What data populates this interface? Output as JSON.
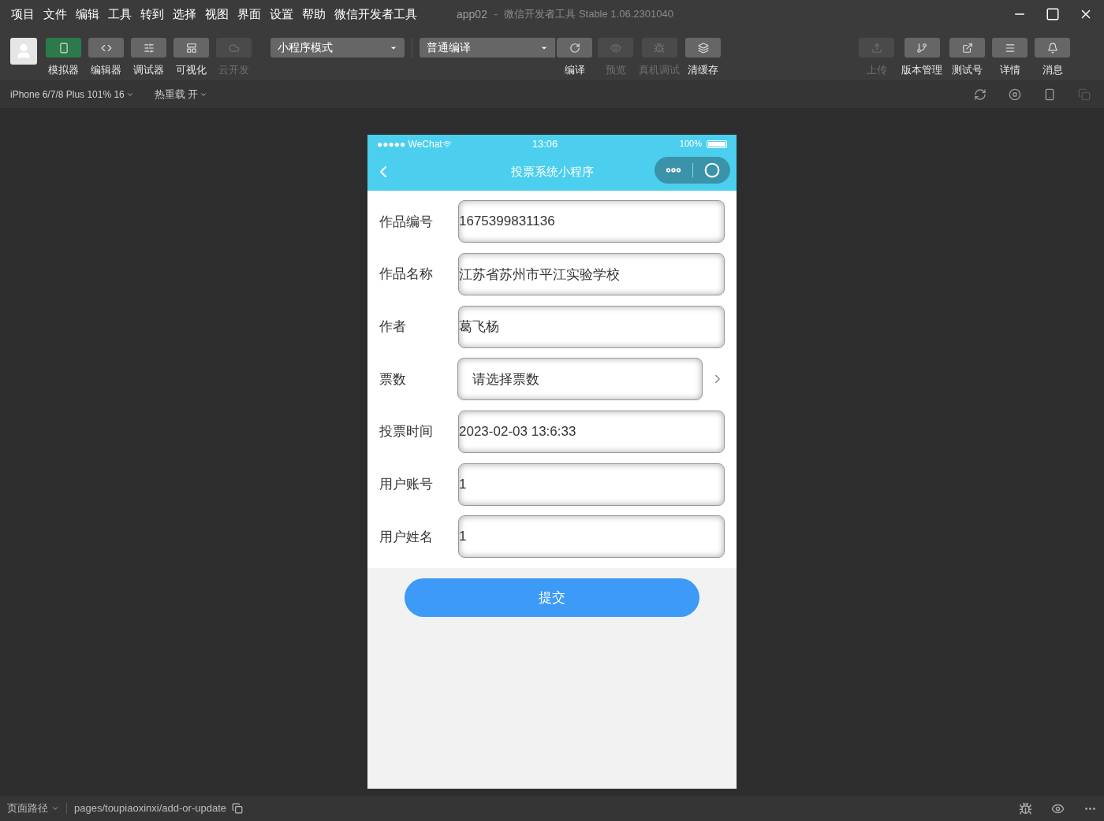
{
  "menu": [
    "项目",
    "文件",
    "编辑",
    "工具",
    "转到",
    "选择",
    "视图",
    "界面",
    "设置",
    "帮助",
    "微信开发者工具"
  ],
  "window": {
    "title": "app02",
    "separator": "-",
    "subtitle": "微信开发者工具 Stable 1.06.2301040"
  },
  "left_tools": [
    {
      "kind": "phone",
      "label": "模拟器",
      "selected": true,
      "disabled": false
    },
    {
      "kind": "code",
      "label": "编辑器",
      "selected": false,
      "disabled": false
    },
    {
      "kind": "sliders",
      "label": "调试器",
      "selected": false,
      "disabled": false
    },
    {
      "kind": "layout",
      "label": "可视化",
      "selected": false,
      "disabled": false
    },
    {
      "kind": "cloud",
      "label": "云开发",
      "selected": false,
      "disabled": true
    }
  ],
  "mode_select": "小程序模式",
  "compile_select": "普通编译",
  "compile_tools": [
    {
      "kind": "refresh",
      "label": "编译",
      "disabled": false
    },
    {
      "kind": "eye",
      "label": "预览",
      "disabled": true
    },
    {
      "kind": "bug",
      "label": "真机调试",
      "disabled": true
    },
    {
      "kind": "layers",
      "label": "清缓存",
      "disabled": false
    }
  ],
  "right_tools": [
    {
      "kind": "upload",
      "label": "上传",
      "disabled": true
    },
    {
      "kind": "branch",
      "label": "版本管理",
      "disabled": false
    },
    {
      "kind": "external",
      "label": "测试号",
      "disabled": false
    },
    {
      "kind": "menu",
      "label": "详情",
      "disabled": false
    },
    {
      "kind": "bell",
      "label": "消息",
      "disabled": false
    }
  ],
  "device_bar": {
    "device": "iPhone 6/7/8 Plus 101% 16",
    "hot_reload": "热重载 开"
  },
  "phone": {
    "status": {
      "carrier": "●●●●● WeChat",
      "time": "13:06",
      "battery": "100%"
    },
    "nav_title": "投票系统小程序",
    "fields": [
      {
        "kind": "input",
        "label": "作品编号",
        "value": "1675399831136"
      },
      {
        "kind": "input",
        "label": "作品名称",
        "value": "江苏省苏州市平江实验学校"
      },
      {
        "kind": "input",
        "label": "作者",
        "value": "葛飞杨"
      },
      {
        "kind": "picker",
        "label": "票数",
        "placeholder": "请选择票数"
      },
      {
        "kind": "input",
        "label": "投票时间",
        "value": "2023-02-03 13:6:33"
      },
      {
        "kind": "input",
        "label": "用户账号",
        "value": "1"
      },
      {
        "kind": "input",
        "label": "用户姓名",
        "value": "1"
      }
    ],
    "submit": "提交"
  },
  "status_bar": {
    "path_label": "页面路径",
    "path": "pages/toupiaoxinxi/add-or-update"
  }
}
